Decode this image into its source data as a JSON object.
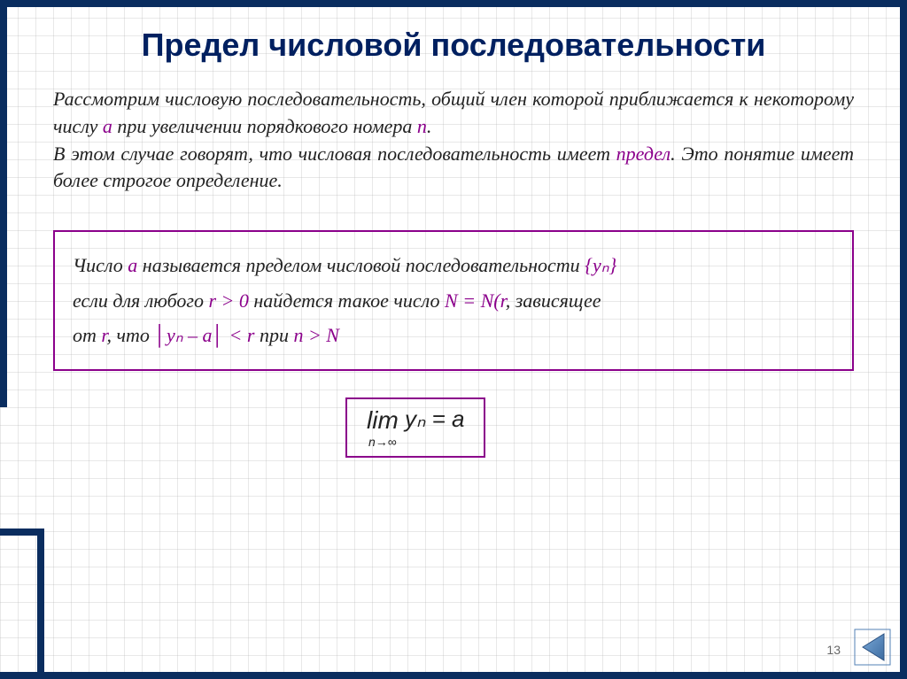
{
  "title": "Предел числовой последовательности",
  "intro": {
    "line1_before_a": "Рассмотрим числовую последовательность, общий член которой приближается к некоторому числу ",
    "a": "a",
    "line1_after_a": " при увеличении порядкового номера ",
    "n": "n",
    "line1_end": ".",
    "line2_before": "В этом случае говорят, что числовая последовательность имеет ",
    "limit_word": "предел",
    "line2_after": ". Это понятие имеет более строгое определение."
  },
  "definition": {
    "part1_before": "Число ",
    "a": "a",
    "part1_after": " называется пределом числовой последовательности ",
    "yn_braces": "{yₙ}",
    "part2_before": "если для любого ",
    "r_gt_0": "r > 0",
    "part2_mid": "  найдется такое число ",
    "N_eq": "N = N(r",
    "part2_after": ", зависящее",
    "part3_before": "от ",
    "r": "r",
    "part3_mid": ", что ",
    "abs_expr": "│yₙ – a│",
    "lt_r": " < r ",
    "pri": "при ",
    "n_gt_N": "n > N"
  },
  "formula": {
    "lim": "lim",
    "subscript": "n→∞",
    "body": " yₙ = a"
  },
  "page_number": "13",
  "nav": {
    "back_label": "back-button"
  }
}
